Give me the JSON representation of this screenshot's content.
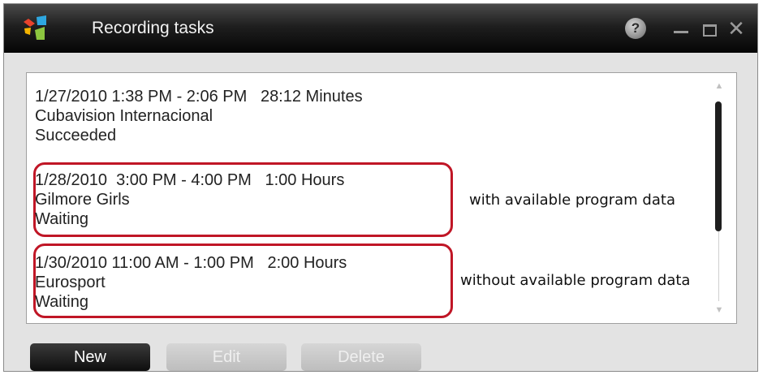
{
  "window": {
    "title": "Recording tasks",
    "help_symbol": "?",
    "close_symbol": "✕"
  },
  "tasks": [
    {
      "time": "1/27/2010 1:38 PM - 2:06 PM   28:12 Minutes",
      "channel": "Cubavision Internacional",
      "status": "Succeeded"
    },
    {
      "time": "1/28/2010  3:00 PM - 4:00 PM   1:00 Hours",
      "channel": "Gilmore Girls",
      "status": "Waiting"
    },
    {
      "time": "1/30/2010 11:00 AM - 1:00 PM   2:00 Hours",
      "channel": "Eurosport",
      "status": "Waiting"
    }
  ],
  "annotations": {
    "with_data": "with available program data",
    "without_data": "without available program data"
  },
  "buttons": {
    "new": "New",
    "edit": "Edit",
    "delete": "Delete"
  },
  "colors": {
    "highlight": "#c01626",
    "titlebar": "#1f1f1f"
  },
  "icons": {
    "logo": "app-logo-icon",
    "help": "help-icon",
    "minimize": "minimize-icon",
    "maximize": "maximize-icon",
    "close": "close-icon"
  }
}
